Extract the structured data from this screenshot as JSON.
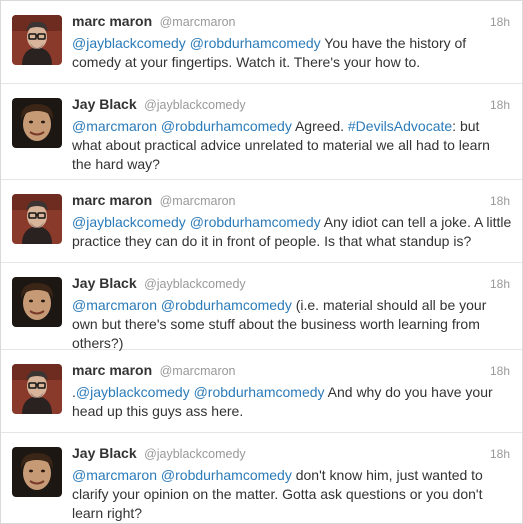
{
  "tweets": [
    {
      "name": "marc maron",
      "handle": "@marcmaron",
      "time": "18h",
      "avatar": "marc-maron-avatar",
      "segments": [
        {
          "type": "mention",
          "text": "@jayblackcomedy"
        },
        {
          "type": "text",
          "text": " "
        },
        {
          "type": "mention",
          "text": "@robdurhamcomedy"
        },
        {
          "type": "text",
          "text": " You have the history of comedy at your fingertips. Watch it. There's your how to."
        }
      ]
    },
    {
      "name": "Jay Black",
      "handle": "@jayblackcomedy",
      "time": "18h",
      "avatar": "jay-black-avatar",
      "segments": [
        {
          "type": "mention",
          "text": "@marcmaron"
        },
        {
          "type": "text",
          "text": " "
        },
        {
          "type": "mention",
          "text": "@robdurhamcomedy"
        },
        {
          "type": "text",
          "text": " Agreed. "
        },
        {
          "type": "hashtag",
          "text": "#DevilsAdvocate"
        },
        {
          "type": "text",
          "text": ": but what about practical advice unrelated to material we all had to learn the hard way?"
        }
      ]
    },
    {
      "name": "marc maron",
      "handle": "@marcmaron",
      "time": "18h",
      "avatar": "marc-maron-avatar",
      "segments": [
        {
          "type": "mention",
          "text": "@jayblackcomedy"
        },
        {
          "type": "text",
          "text": " "
        },
        {
          "type": "mention",
          "text": "@robdurhamcomedy"
        },
        {
          "type": "text",
          "text": " Any idiot can tell a joke. A little practice they can do it in front of people. Is that what standup is?"
        }
      ]
    },
    {
      "name": "Jay Black",
      "handle": "@jayblackcomedy",
      "time": "18h",
      "avatar": "jay-black-avatar",
      "segments": [
        {
          "type": "mention",
          "text": "@marcmaron"
        },
        {
          "type": "text",
          "text": " "
        },
        {
          "type": "mention",
          "text": "@robdurhamcomedy"
        },
        {
          "type": "text",
          "text": " (i.e. material should all be your own but there's some stuff about the business worth learning from others?)"
        }
      ]
    },
    {
      "name": "marc maron",
      "handle": "@marcmaron",
      "time": "18h",
      "avatar": "marc-maron-avatar",
      "segments": [
        {
          "type": "text",
          "text": "."
        },
        {
          "type": "mention",
          "text": "@jayblackcomedy"
        },
        {
          "type": "text",
          "text": " "
        },
        {
          "type": "mention",
          "text": "@robdurhamcomedy"
        },
        {
          "type": "text",
          "text": " And why do you have your head up this guys ass here."
        }
      ]
    },
    {
      "name": "Jay Black",
      "handle": "@jayblackcomedy",
      "time": "18h",
      "avatar": "jay-black-avatar",
      "segments": [
        {
          "type": "mention",
          "text": "@marcmaron"
        },
        {
          "type": "text",
          "text": " "
        },
        {
          "type": "mention",
          "text": "@robdurhamcomedy"
        },
        {
          "type": "text",
          "text": " don't know him, just wanted to clarify your opinion on the matter. Gotta ask questions or you don't learn right?"
        }
      ]
    }
  ],
  "colors": {
    "link": "#2b7bb9",
    "text": "#333333",
    "muted": "#999999",
    "border": "#e6e6e6"
  }
}
